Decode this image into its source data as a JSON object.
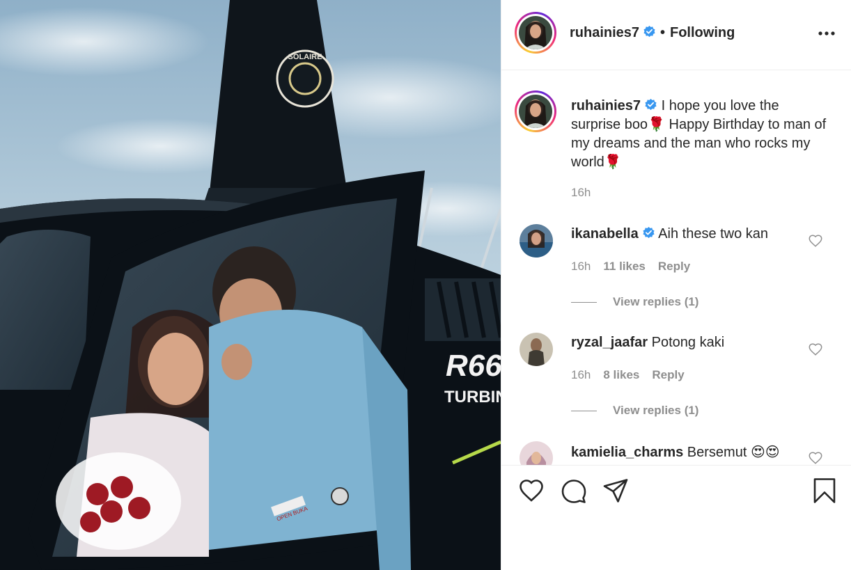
{
  "post": {
    "author": "ruhainies7",
    "follow_status": "Following",
    "separator": "•",
    "caption": "I hope you love the surprise boo🌹 Happy Birthday to man of my dreams and the man who rocks my world🌹",
    "caption_time": "16h",
    "photo_texts": {
      "logo": "SOLAIRE",
      "model": "R66",
      "engine": "TURBINE",
      "door_label": "OPEN BUKA"
    }
  },
  "comments": [
    {
      "username": "ikanabella",
      "verified": true,
      "text": "Aih these two kan",
      "time": "16h",
      "likes": "11 likes",
      "reply": "Reply",
      "view_replies": "View replies (1)"
    },
    {
      "username": "ryzal_jaafar",
      "verified": false,
      "text": "Potong kaki",
      "time": "16h",
      "likes": "8 likes",
      "reply": "Reply",
      "view_replies": "View replies (1)"
    },
    {
      "username": "kamielia_charms",
      "verified": false,
      "text": "Bersemut 😍😍"
    }
  ],
  "icons": {
    "like": "heart-icon",
    "comment": "comment-icon",
    "share": "paper-plane-icon",
    "save": "bookmark-icon",
    "more": "more-options-icon",
    "verified": "verified-badge-icon"
  },
  "colors": {
    "text": "#262626",
    "secondary": "#8e8e8e",
    "verified": "#3897f0",
    "divider": "#efefef"
  }
}
